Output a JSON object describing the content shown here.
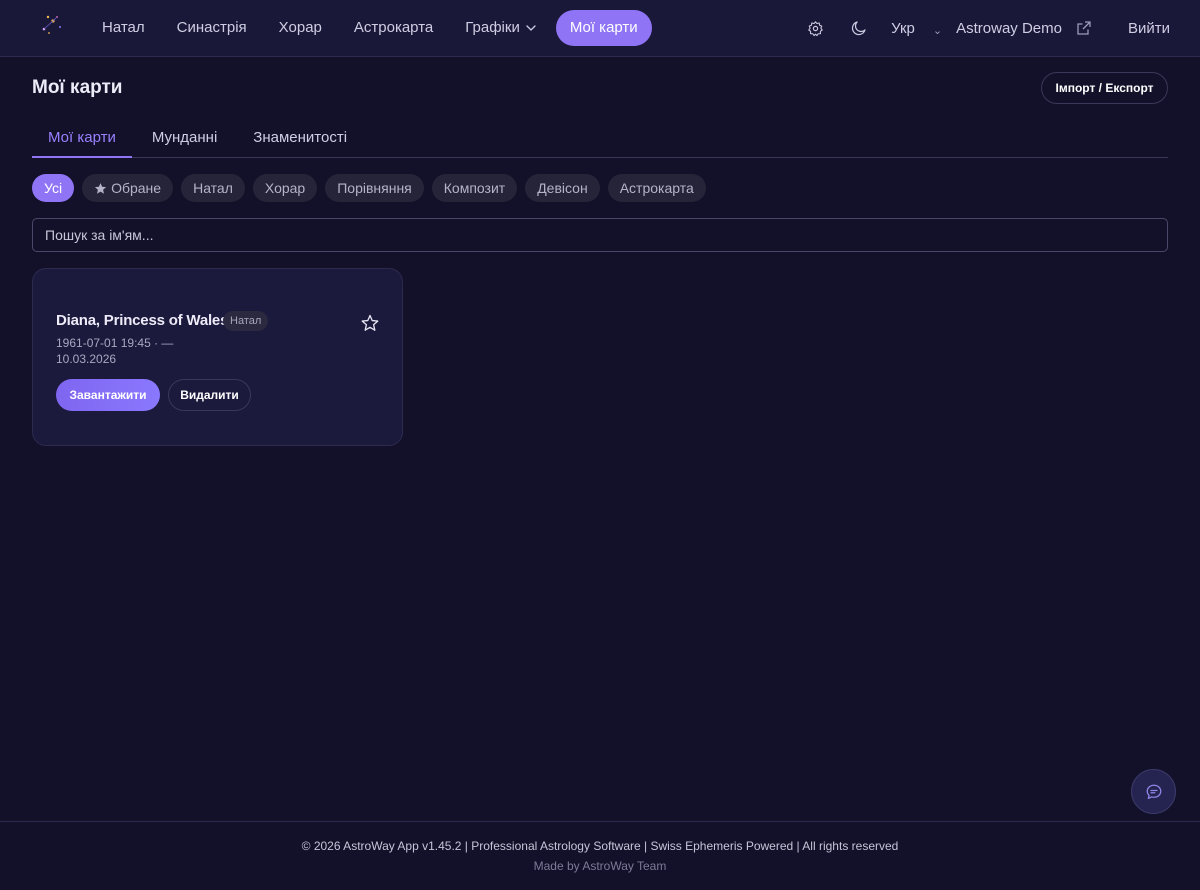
{
  "nav": {
    "links": [
      "Натал",
      "Синастрія",
      "Хорар",
      "Астрокарта"
    ],
    "charts_label": "Графіки",
    "active_label": "Мої карти",
    "lang": "Укр",
    "user": "Astroway Demo",
    "logout": "Вийти"
  },
  "page": {
    "title": "Мої карти",
    "import_export": "Імпорт / Експорт"
  },
  "tabs": [
    {
      "label": "Мої карти",
      "active": true
    },
    {
      "label": "Мунданні",
      "active": false
    },
    {
      "label": "Знаменитості",
      "active": false
    }
  ],
  "filters": [
    {
      "label": "Усі",
      "active": true
    },
    {
      "label": "Обране",
      "active": false,
      "icon": "star-icon"
    },
    {
      "label": "Натал",
      "active": false
    },
    {
      "label": "Хорар",
      "active": false
    },
    {
      "label": "Порівняння",
      "active": false
    },
    {
      "label": "Композит",
      "active": false
    },
    {
      "label": "Девісон",
      "active": false
    },
    {
      "label": "Астрокарта",
      "active": false
    }
  ],
  "search": {
    "placeholder": "Пошук за ім'ям...",
    "value": ""
  },
  "cards": [
    {
      "name": "Diana, Princess of Wales",
      "badge": "Натал",
      "meta": "1961-07-01 19:45 · — 10.03.2026",
      "load_label": "Завантажити",
      "delete_label": "Видалити"
    }
  ],
  "footer": {
    "main": "© 2026 AstroWay App v1.45.2 | Professional Astrology Software | Swiss Ephemeris Powered | All rights reserved",
    "sub": "Made by AstroWay Team"
  },
  "colors": {
    "accent": "#8f75f5",
    "background": "#13112a",
    "topbar": "#1a1838",
    "card": "#1c1a3c"
  }
}
